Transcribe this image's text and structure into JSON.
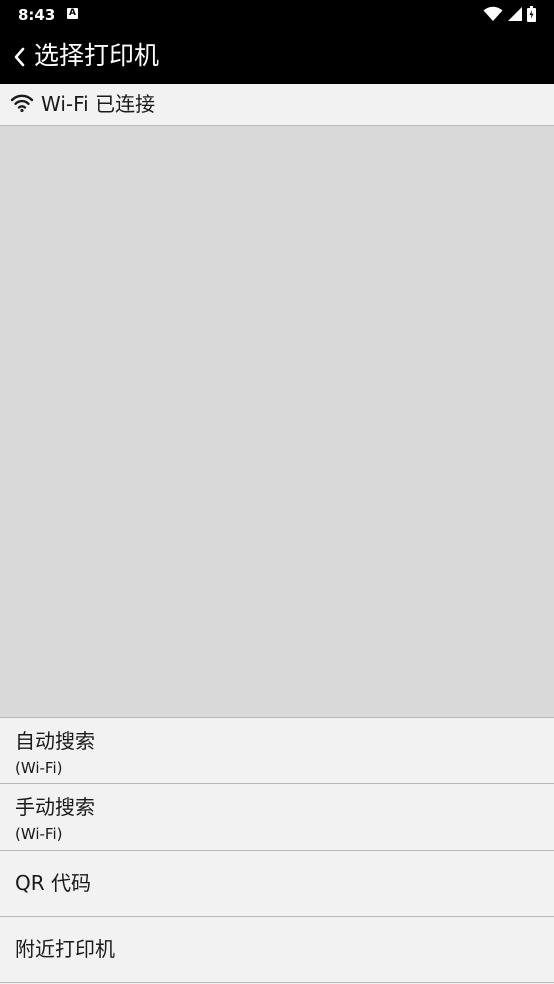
{
  "status_bar": {
    "time": "8:43",
    "notification_letter": "A"
  },
  "app_bar": {
    "title": "选择打印机"
  },
  "connection": {
    "text": "Wi-Fi 已连接"
  },
  "options": {
    "auto_search": {
      "title": "自动搜索",
      "subtitle": "(Wi-Fi)"
    },
    "manual_search": {
      "title": "手动搜索",
      "subtitle": "(Wi-Fi)"
    },
    "qr_code": {
      "title": "QR 代码"
    },
    "nearby_printers": {
      "title": "附近打印机"
    }
  },
  "icons": [
    "chevron-left-icon",
    "wifi-icon",
    "signal-icon",
    "battery-icon"
  ],
  "colors": {
    "bar_background": "#000000",
    "list_background": "#d9d9d9",
    "row_background": "#f2f2f2",
    "divider": "#b8b8b8"
  }
}
